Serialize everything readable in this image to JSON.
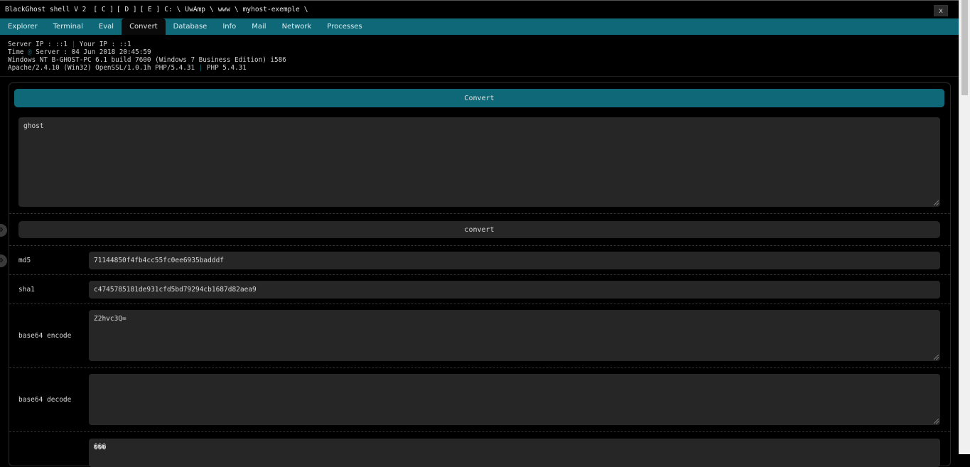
{
  "titlebar": {
    "app": "BlackGhost shell V 2",
    "drives": [
      "[ C ]",
      "[ D ]",
      "[ E ]"
    ],
    "path_parts": [
      "C:",
      "UwAmp",
      "www",
      "myhost-exemple"
    ],
    "path_sep": "\\",
    "close": "x"
  },
  "tabs": [
    "Explorer",
    "Terminal",
    "Eval",
    "Convert",
    "Database",
    "Info",
    "Mail",
    "Network",
    "Processes"
  ],
  "active_tab": "Convert",
  "info": {
    "server_ip": "Server IP : ::1",
    "your_ip": "Your IP : ::1",
    "time_label": "Time",
    "time_value": "Server : 04 Jun 2018 20:45:59",
    "os": "Windows NT B-GHOST-PC 6.1 build 7600 (Windows 7 Business Edition) i586",
    "server_sw": "Apache/2.4.10 (Win32) OpenSSL/1.0.1h PHP/5.4.31",
    "php": "PHP 5.4.31",
    "pipe": "|",
    "at": "@"
  },
  "convert": {
    "header": "Convert",
    "input_value": "ghost",
    "button": "convert",
    "rows": [
      {
        "label": "md5",
        "value": "71144850f4fb4cc55fc0ee6935badddf"
      },
      {
        "label": "sha1",
        "value": "c4745785181de931cfd5bd79294cb1687d82aea9"
      },
      {
        "label": "base64 encode",
        "value": "Z2hvc3Q="
      },
      {
        "label": "base64 decode",
        "value": ""
      },
      {
        "label": "",
        "value": "���"
      }
    ]
  },
  "colors": {
    "accent": "#0e6878",
    "background": "#000000",
    "field": "#262626"
  },
  "icons": {
    "close": "close-icon",
    "side": "gear-icon"
  }
}
